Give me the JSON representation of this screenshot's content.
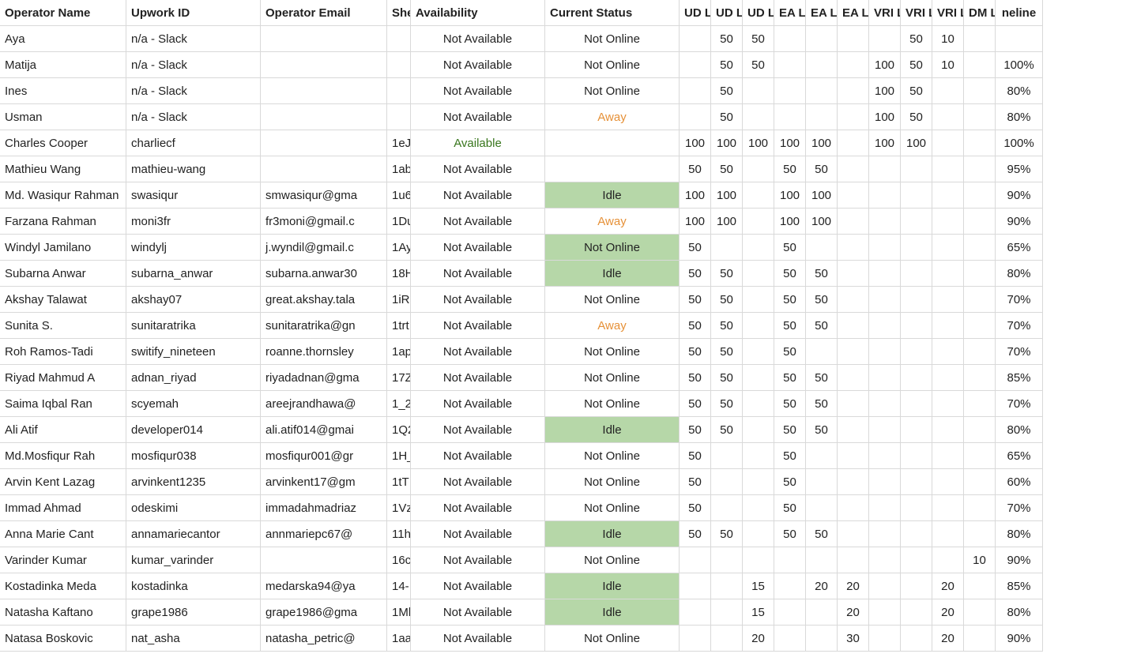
{
  "columns": [
    "Operator Name",
    "Upwork ID",
    "Operator Email",
    "She",
    "Availability",
    "Current Status",
    "UD L",
    "UD L",
    "UD L",
    "EA L",
    "EA L",
    "EA L",
    "VRI L",
    "VRI L",
    "VRI L",
    "DM L",
    "neline"
  ],
  "rows": [
    {
      "name": "Aya",
      "upwork": "n/a - Slack",
      "email": "",
      "sheet": "",
      "avail": "Not Available",
      "status": "Not Online",
      "statusStyle": "plain",
      "v": [
        "",
        "50",
        "50",
        "",
        "",
        "",
        "",
        "50",
        "10",
        "",
        ""
      ]
    },
    {
      "name": "Matija",
      "upwork": "n/a - Slack",
      "email": "",
      "sheet": "",
      "avail": "Not Available",
      "status": "Not Online",
      "statusStyle": "plain",
      "v": [
        "",
        "50",
        "50",
        "",
        "",
        "",
        "100",
        "50",
        "10",
        "",
        "100%"
      ]
    },
    {
      "name": "Ines",
      "upwork": "n/a - Slack",
      "email": "",
      "sheet": "",
      "avail": "Not Available",
      "status": "Not Online",
      "statusStyle": "plain",
      "v": [
        "",
        "50",
        "",
        "",
        "",
        "",
        "100",
        "50",
        "",
        "",
        "80%"
      ]
    },
    {
      "name": "Usman",
      "upwork": "n/a - Slack",
      "email": "",
      "sheet": "",
      "avail": "Not Available",
      "status": "Away",
      "statusStyle": "away",
      "v": [
        "",
        "50",
        "",
        "",
        "",
        "",
        "100",
        "50",
        "",
        "",
        "80%"
      ]
    },
    {
      "name": "Charles Cooper",
      "upwork": "charliecf",
      "email": "",
      "sheet": "1eJ",
      "avail": "Available",
      "status": "",
      "statusStyle": "none",
      "v": [
        "100",
        "100",
        "100",
        "100",
        "100",
        "",
        "100",
        "100",
        "",
        "",
        "100%"
      ]
    },
    {
      "name": "Mathieu Wang",
      "upwork": "mathieu-wang",
      "email": "",
      "sheet": "1ab",
      "avail": "Not Available",
      "status": "",
      "statusStyle": "none",
      "v": [
        "50",
        "50",
        "",
        "50",
        "50",
        "",
        "",
        "",
        "",
        "",
        "95%"
      ]
    },
    {
      "name": "Md. Wasiqur Rahman",
      "upwork": "swasiqur",
      "email": "smwasiqur@gma",
      "sheet": "1u6",
      "avail": "Not Available",
      "status": "Idle",
      "statusStyle": "idle-bg",
      "v": [
        "100",
        "100",
        "",
        "100",
        "100",
        "",
        "",
        "",
        "",
        "",
        "90%"
      ]
    },
    {
      "name": "Farzana Rahman",
      "upwork": "moni3fr",
      "email": "fr3moni@gmail.c",
      "sheet": "1Du",
      "avail": "Not Available",
      "status": "Away",
      "statusStyle": "away",
      "v": [
        "100",
        "100",
        "",
        "100",
        "100",
        "",
        "",
        "",
        "",
        "",
        "90%"
      ]
    },
    {
      "name": "Windyl Jamilano",
      "upwork": "windylj",
      "email": "j.wyndil@gmail.c",
      "sheet": "1Ay",
      "avail": "Not Available",
      "status": "Not Online",
      "statusStyle": "notonline-bg",
      "v": [
        "50",
        "",
        "",
        "50",
        "",
        "",
        "",
        "",
        "",
        "",
        "65%"
      ]
    },
    {
      "name": "Subarna Anwar",
      "upwork": "subarna_anwar",
      "email": "subarna.anwar30",
      "sheet": "18H",
      "avail": "Not Available",
      "status": "Idle",
      "statusStyle": "idle-bg",
      "v": [
        "50",
        "50",
        "",
        "50",
        "50",
        "",
        "",
        "",
        "",
        "",
        "80%"
      ]
    },
    {
      "name": "Akshay Talawat",
      "upwork": "akshay07",
      "email": "great.akshay.tala",
      "sheet": "1iR",
      "avail": "Not Available",
      "status": "Not Online",
      "statusStyle": "plain",
      "v": [
        "50",
        "50",
        "",
        "50",
        "50",
        "",
        "",
        "",
        "",
        "",
        "70%"
      ]
    },
    {
      "name": "Sunita S.",
      "upwork": "sunitaratrika",
      "email": "sunitaratrika@gn",
      "sheet": "1trt",
      "avail": "Not Available",
      "status": "Away",
      "statusStyle": "away",
      "v": [
        "50",
        "50",
        "",
        "50",
        "50",
        "",
        "",
        "",
        "",
        "",
        "70%"
      ]
    },
    {
      "name": "Roh Ramos-Tadi",
      "upwork": "switify_nineteen",
      "email": "roanne.thornsley",
      "sheet": "1ap",
      "avail": "Not Available",
      "status": "Not Online",
      "statusStyle": "plain",
      "v": [
        "50",
        "50",
        "",
        "50",
        "",
        "",
        "",
        "",
        "",
        "",
        "70%"
      ]
    },
    {
      "name": "Riyad Mahmud A",
      "upwork": "adnan_riyad",
      "email": "riyadadnan@gma",
      "sheet": "17Z",
      "avail": "Not Available",
      "status": "Not Online",
      "statusStyle": "plain",
      "v": [
        "50",
        "50",
        "",
        "50",
        "50",
        "",
        "",
        "",
        "",
        "",
        "85%"
      ]
    },
    {
      "name": "Saima Iqbal Ran",
      "upwork": "scyemah",
      "email": "areejrandhawa@",
      "sheet": "1_2",
      "avail": "Not Available",
      "status": "Not Online",
      "statusStyle": "plain",
      "v": [
        "50",
        "50",
        "",
        "50",
        "50",
        "",
        "",
        "",
        "",
        "",
        "70%"
      ]
    },
    {
      "name": "Ali Atif",
      "upwork": "developer014",
      "email": "ali.atif014@gmai",
      "sheet": "1Q2",
      "avail": "Not Available",
      "status": "Idle",
      "statusStyle": "idle-bg",
      "v": [
        "50",
        "50",
        "",
        "50",
        "50",
        "",
        "",
        "",
        "",
        "",
        "80%"
      ]
    },
    {
      "name": "Md.Mosfiqur Rah",
      "upwork": "mosfiqur038",
      "email": "mosfiqur001@gr",
      "sheet": "1H_",
      "avail": "Not Available",
      "status": "Not Online",
      "statusStyle": "plain",
      "v": [
        "50",
        "",
        "",
        "50",
        "",
        "",
        "",
        "",
        "",
        "",
        "65%"
      ]
    },
    {
      "name": "Arvin Kent Lazag",
      "upwork": "arvinkent1235",
      "email": "arvinkent17@gm",
      "sheet": "1tT",
      "avail": "Not Available",
      "status": "Not Online",
      "statusStyle": "plain",
      "v": [
        "50",
        "",
        "",
        "50",
        "",
        "",
        "",
        "",
        "",
        "",
        "60%"
      ]
    },
    {
      "name": "Immad Ahmad",
      "upwork": "odeskimi",
      "email": "immadahmadriaz",
      "sheet": "1Vz",
      "avail": "Not Available",
      "status": "Not Online",
      "statusStyle": "plain",
      "v": [
        "50",
        "",
        "",
        "50",
        "",
        "",
        "",
        "",
        "",
        "",
        "70%"
      ]
    },
    {
      "name": "Anna Marie Cant",
      "upwork": "annamariecantor",
      "email": "annmariepc67@",
      "sheet": "11h",
      "avail": "Not Available",
      "status": "Idle",
      "statusStyle": "idle-bg",
      "v": [
        "50",
        "50",
        "",
        "50",
        "50",
        "",
        "",
        "",
        "",
        "",
        "80%"
      ]
    },
    {
      "name": "Varinder Kumar",
      "upwork": "kumar_varinder",
      "email": "",
      "sheet": "16c",
      "avail": "Not Available",
      "status": "Not Online",
      "statusStyle": "plain",
      "v": [
        "",
        "",
        "",
        "",
        "",
        "",
        "",
        "",
        "",
        "10",
        "90%"
      ]
    },
    {
      "name": "Kostadinka Meda",
      "upwork": "kostadinka",
      "email": "medarska94@ya",
      "sheet": "14-",
      "avail": "Not Available",
      "status": "Idle",
      "statusStyle": "idle-bg",
      "v": [
        "",
        "",
        "15",
        "",
        "20",
        "20",
        "",
        "",
        "20",
        "",
        "85%"
      ]
    },
    {
      "name": "Natasha Kaftano",
      "upwork": "grape1986",
      "email": "grape1986@gma",
      "sheet": "1Ml",
      "avail": "Not Available",
      "status": "Idle",
      "statusStyle": "idle-bg",
      "v": [
        "",
        "",
        "15",
        "",
        "",
        "20",
        "",
        "",
        "20",
        "",
        "80%"
      ]
    },
    {
      "name": "Natasa Boskovic",
      "upwork": "nat_asha",
      "email": "natasha_petric@",
      "sheet": "1aa",
      "avail": "Not Available",
      "status": "Not Online",
      "statusStyle": "plain",
      "v": [
        "",
        "",
        "20",
        "",
        "",
        "30",
        "",
        "",
        "20",
        "",
        "90%"
      ]
    }
  ]
}
